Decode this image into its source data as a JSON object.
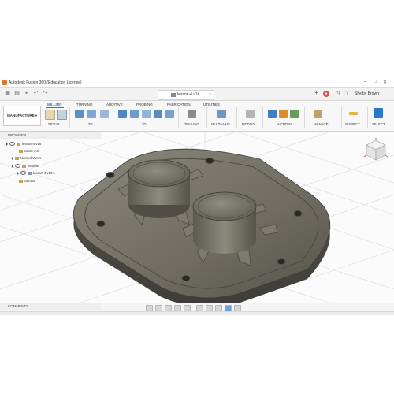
{
  "window": {
    "title": "Autodesk Fusion 360 (Education License)",
    "document_tab": "lesson-4 v16",
    "user": "Shelby Brown"
  },
  "workspace": {
    "label": "MANUFACTURE"
  },
  "ribbon": {
    "tabs": [
      "MILLING",
      "TURNING",
      "ADDITIVE",
      "PROBING",
      "FABRICATION",
      "UTILITIES"
    ],
    "active_tab": "MILLING",
    "groups": [
      "SETUP",
      "2D",
      "3D",
      "DRILLING",
      "MULTI-AXIS",
      "MODIFY",
      "ACTIONS",
      "MANAGE",
      "INSPECT",
      "SELECT"
    ]
  },
  "browser": {
    "header": "BROWSER",
    "items": [
      "lesson-4 v16",
      "Units: mm",
      "Named Views",
      "Models",
      "lesson-4 v16:1",
      "Setups"
    ]
  },
  "comments": {
    "header": "COMMENTS"
  },
  "colors": {
    "accent": "#2a78c8",
    "part_body": "#6f6c62",
    "ribbon_bg": "#f7f7f7",
    "viewcube_z": "#2f8fdc"
  },
  "icons": [
    "fusion-logo-icon",
    "grid-menu-icon",
    "save-icon",
    "undo-icon",
    "redo-icon",
    "close-icon",
    "add-tab-icon",
    "clock-icon",
    "help-icon",
    "eye-icon",
    "folder-icon",
    "component-icon",
    "viewcube-icon",
    "orbit-icon",
    "pan-icon",
    "zoom-icon",
    "fit-icon",
    "display-icon",
    "grid-icon"
  ]
}
